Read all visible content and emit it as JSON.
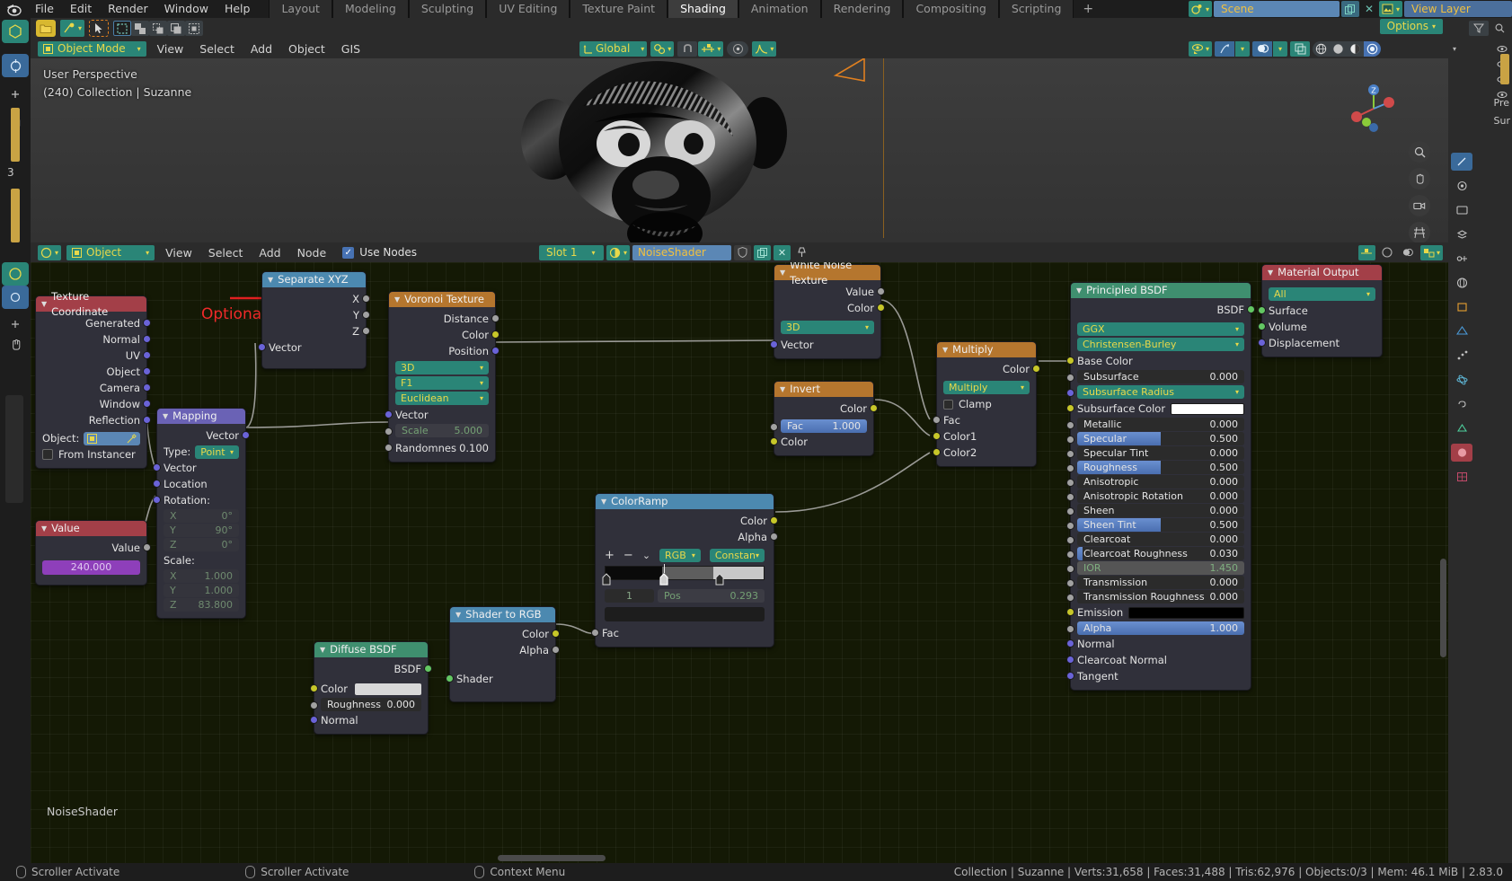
{
  "app": {
    "menus": [
      "File",
      "Edit",
      "Render",
      "Window",
      "Help"
    ],
    "workspace_tabs": [
      {
        "label": "Layout",
        "active": false
      },
      {
        "label": "Modeling",
        "active": false
      },
      {
        "label": "Sculpting",
        "active": false
      },
      {
        "label": "UV Editing",
        "active": false
      },
      {
        "label": "Texture Paint",
        "active": false
      },
      {
        "label": "Shading",
        "active": true
      },
      {
        "label": "Animation",
        "active": false
      },
      {
        "label": "Rendering",
        "active": false
      },
      {
        "label": "Compositing",
        "active": false
      },
      {
        "label": "Scripting",
        "active": false
      }
    ],
    "add_workspace": "+",
    "scene_name": "Scene",
    "view_layer_name": "View Layer"
  },
  "viewport": {
    "mode": "Object Mode",
    "menus": [
      "View",
      "Select",
      "Add",
      "Object",
      "GIS"
    ],
    "transform_orientation": "Global",
    "overlay_text_line1": "User Perspective",
    "overlay_text_line2": "(240) Collection | Suzanne",
    "options_label": "Options",
    "gizmo_axes": [
      "X",
      "Y",
      "Z"
    ]
  },
  "shader_editor": {
    "id_type": "Object",
    "menus": [
      "View",
      "Select",
      "Add",
      "Node"
    ],
    "use_nodes_label": "Use Nodes",
    "use_nodes_checked": true,
    "slot": "Slot 1",
    "material_name": "NoiseShader",
    "canvas_label": "NoiseShader",
    "annotation": "Optional"
  },
  "nodes": {
    "texture_coordinate": {
      "title": "Texture Coordinate",
      "header_color": "#a33f48",
      "outputs": [
        "Generated",
        "Normal",
        "UV",
        "Object",
        "Camera",
        "Window",
        "Reflection"
      ],
      "object_label": "Object:",
      "object_value": "",
      "from_instancer_label": "From Instancer",
      "from_instancer_checked": false
    },
    "value": {
      "title": "Value",
      "header_color": "#a33f48",
      "output_label": "Value",
      "value": "240.000"
    },
    "mapping": {
      "title": "Mapping",
      "header_color": "#6a62b5",
      "output_label": "Vector",
      "type_label": "Type:",
      "type_value": "Point",
      "input_vector": "Vector",
      "input_location": "Location",
      "rotation_label": "Rotation:",
      "rotation": [
        {
          "axis": "X",
          "value": "0°"
        },
        {
          "axis": "Y",
          "value": "90°"
        },
        {
          "axis": "Z",
          "value": "0°"
        }
      ],
      "scale_label": "Scale:",
      "scale": [
        {
          "axis": "X",
          "value": "1.000"
        },
        {
          "axis": "Y",
          "value": "1.000"
        },
        {
          "axis": "Z",
          "value": "83.800"
        }
      ]
    },
    "separate_xyz": {
      "title": "Separate XYZ",
      "header_color": "#4c89b0",
      "outputs": [
        "X",
        "Y",
        "Z"
      ],
      "input": "Vector"
    },
    "voronoi": {
      "title": "Voronoi Texture",
      "header_color": "#b5762e",
      "outputs": [
        "Distance",
        "Color",
        "Position"
      ],
      "enum_dimensions": "3D",
      "enum_feature": "F1",
      "enum_metric": "Euclidean",
      "input_vector": "Vector",
      "scale_label": "Scale",
      "scale_value": "5.000",
      "randomness_label": "Randomnes",
      "randomness_value": "0.100"
    },
    "white_noise": {
      "title": "White Noise Texture",
      "header_color": "#b5762e",
      "outputs": [
        "Value",
        "Color"
      ],
      "enum_dimensions": "3D",
      "input_vector": "Vector"
    },
    "invert": {
      "title": "Invert",
      "header_color": "#b5762e",
      "output": "Color",
      "fac_label": "Fac",
      "fac_value": "1.000",
      "input_color": "Color"
    },
    "multiply": {
      "title": "Multiply",
      "header_color": "#b5762e",
      "output": "Color",
      "operation": "Multiply",
      "clamp_label": "Clamp",
      "clamp_checked": false,
      "inputs": [
        "Fac",
        "Color1",
        "Color2"
      ]
    },
    "colorramp": {
      "title": "ColorRamp",
      "header_color": "#4c89b0",
      "outputs": [
        "Color",
        "Alpha"
      ],
      "buttons": [
        "+",
        "−",
        "⌄"
      ],
      "interpolation_mode": "RGB",
      "interpolation_type": "Constan",
      "index_value": "1",
      "pos_label": "Pos",
      "pos_value": "0.293",
      "input_fac": "Fac"
    },
    "shader_to_rgb": {
      "title": "Shader to RGB",
      "header_color": "#4c89b0",
      "outputs": [
        "Color",
        "Alpha"
      ],
      "input": "Shader"
    },
    "diffuse_bsdf": {
      "title": "Diffuse BSDF",
      "header_color": "#3f8f6f",
      "output": "BSDF",
      "input_color_label": "Color",
      "roughness_label": "Roughness",
      "roughness_value": "0.000",
      "normal_label": "Normal"
    },
    "principled_bsdf": {
      "title": "Principled BSDF",
      "header_color": "#3f8f6f",
      "output": "BSDF",
      "enum_distribution": "GGX",
      "enum_subsurface_method": "Christensen-Burley",
      "inputs": [
        {
          "label": "Base Color",
          "type": "color_linked",
          "sock": "s-yellow"
        },
        {
          "label": "Subsurface",
          "value": "0.000",
          "type": "slider",
          "fill": 0,
          "sock": "s-gray"
        },
        {
          "label": "Subsurface Radius",
          "type": "vector",
          "sock": "s-violet"
        },
        {
          "label": "Subsurface Color",
          "type": "swatch",
          "swatch": "#ffffff",
          "sock": "s-yellow"
        },
        {
          "label": "Metallic",
          "value": "0.000",
          "type": "slider",
          "fill": 0,
          "sock": "s-gray"
        },
        {
          "label": "Specular",
          "value": "0.500",
          "type": "slider",
          "fill": 50,
          "sock": "s-gray"
        },
        {
          "label": "Specular Tint",
          "value": "0.000",
          "type": "slider",
          "fill": 0,
          "sock": "s-gray"
        },
        {
          "label": "Roughness",
          "value": "0.500",
          "type": "slider",
          "fill": 50,
          "sock": "s-gray"
        },
        {
          "label": "Anisotropic",
          "value": "0.000",
          "type": "slider",
          "fill": 0,
          "sock": "s-gray"
        },
        {
          "label": "Anisotropic Rotation",
          "value": "0.000",
          "type": "slider",
          "fill": 0,
          "sock": "s-gray"
        },
        {
          "label": "Sheen",
          "value": "0.000",
          "type": "slider",
          "fill": 0,
          "sock": "s-gray"
        },
        {
          "label": "Sheen Tint",
          "value": "0.500",
          "type": "slider",
          "fill": 50,
          "sock": "s-gray"
        },
        {
          "label": "Clearcoat",
          "value": "0.000",
          "type": "slider",
          "fill": 0,
          "sock": "s-gray"
        },
        {
          "label": "Clearcoat Roughness",
          "value": "0.030",
          "type": "slider",
          "fill": 3,
          "sock": "s-gray"
        },
        {
          "label": "IOR",
          "value": "1.450",
          "type": "slider_dim",
          "fill": 0,
          "sock": "s-gray"
        },
        {
          "label": "Transmission",
          "value": "0.000",
          "type": "slider",
          "fill": 0,
          "sock": "s-gray"
        },
        {
          "label": "Transmission Roughness",
          "value": "0.000",
          "type": "slider",
          "fill": 0,
          "sock": "s-gray"
        },
        {
          "label": "Emission",
          "type": "swatch",
          "swatch": "#000000",
          "sock": "s-yellow"
        },
        {
          "label": "Alpha",
          "value": "1.000",
          "type": "slider",
          "fill": 100,
          "sock": "s-gray"
        },
        {
          "label": "Normal",
          "type": "plain",
          "sock": "s-violet"
        },
        {
          "label": "Clearcoat Normal",
          "type": "plain",
          "sock": "s-violet"
        },
        {
          "label": "Tangent",
          "type": "plain",
          "sock": "s-violet"
        }
      ]
    },
    "material_output": {
      "title": "Material Output",
      "header_color": "#a33f48",
      "target": "All",
      "inputs": [
        "Surface",
        "Volume",
        "Displacement"
      ]
    }
  },
  "statusbar": {
    "items": [
      "Scroller Activate",
      "Scroller Activate",
      "Context Menu"
    ],
    "stats": "Collection | Suzanne | Verts:31,658 | Faces:31,488 | Tris:62,976 | Objects:0/3 | Mem: 46.1 MiB | 2.83.0"
  },
  "properties_panel": {
    "labels": [
      "Pre",
      "Sur"
    ]
  }
}
